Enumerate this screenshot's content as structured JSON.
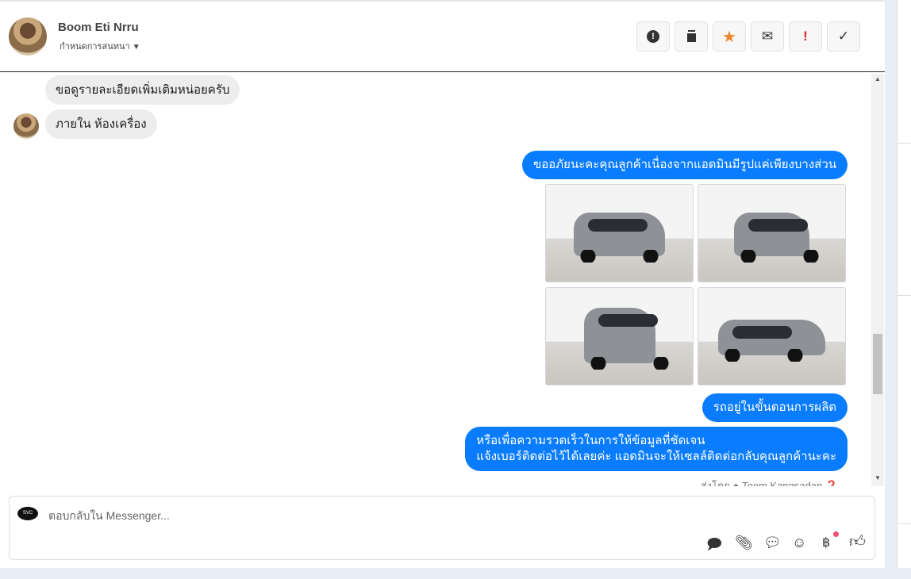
{
  "header": {
    "name": "Boom Eti Nrru",
    "subtitle": "กำหนดการสนทนา"
  },
  "toolbar": [
    {
      "icon": "alert-circle-icon",
      "glyph": "!"
    },
    {
      "icon": "trash-icon",
      "glyph": "🗑"
    },
    {
      "icon": "star-icon",
      "glyph": "★",
      "color": "#f0862e"
    },
    {
      "icon": "envelope-icon",
      "glyph": "✉"
    },
    {
      "icon": "exclamation-icon",
      "glyph": "!",
      "color": "#e02424"
    },
    {
      "icon": "check-icon",
      "glyph": "✓"
    }
  ],
  "messages": {
    "in1": "ขอดูรายละเอียดเพิ่มเติมหน่อยครับ",
    "in2": "ภายใน ห้องเครื่อง",
    "out1": "ขออภัยนะคะคุณลูกค้าเนื่องจากแอดมินมีรูปแค่เพียงบางส่วน",
    "out2": "รถอยู่ในขั้นตอนการผลิต",
    "out3_line1": "หรือเพื่อความรวดเร็วในการให้ข้อมูลที่ชัดเจน",
    "out3_line2": "แจ้งเบอร์ติดต่อไว้ได้เลยค่ะ แอดมินจะให้เซลล์ติดต่อกลับคุณลูกค้านะคะ",
    "sent_by": "ส่งโดย ● Toom Kangsadan ❓"
  },
  "composer": {
    "placeholder": "ตอบกลับใน Messenger...",
    "logo_text": "SVC"
  },
  "colors": {
    "accent": "#0a7cff",
    "bubble_in": "#ededed"
  }
}
